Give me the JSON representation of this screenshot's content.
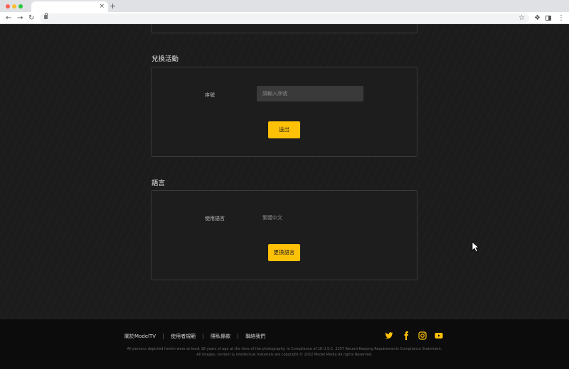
{
  "browser": {
    "tab_close": "×",
    "new_tab": "+"
  },
  "redeem": {
    "title": "兌換活動",
    "serial_label": "序號",
    "serial_placeholder": "請輸入序號",
    "submit_label": "送出"
  },
  "language": {
    "title": "語言",
    "label": "使用語言",
    "value": "繁體中文",
    "change_label": "更換語言"
  },
  "footer": {
    "links": [
      "關於ModelTV",
      "使用者規範",
      "隱私條款",
      "聯絡我們"
    ],
    "legal_line1": "All persons depicted herein were at least 18 years of age at the time of the photography. In Compliance of 18 U.S.C. 2257 Record Keeping Requirements Compliance Statement.",
    "legal_line2": "All images, content & intellectual materials are copyright © 2022 Model Media All rights Reserved."
  },
  "colors": {
    "accent": "#ffc107",
    "background": "#1c1c1c",
    "footer": "#0c0c0c"
  },
  "icons": [
    "twitter-icon",
    "facebook-icon",
    "instagram-icon",
    "youtube-icon"
  ]
}
